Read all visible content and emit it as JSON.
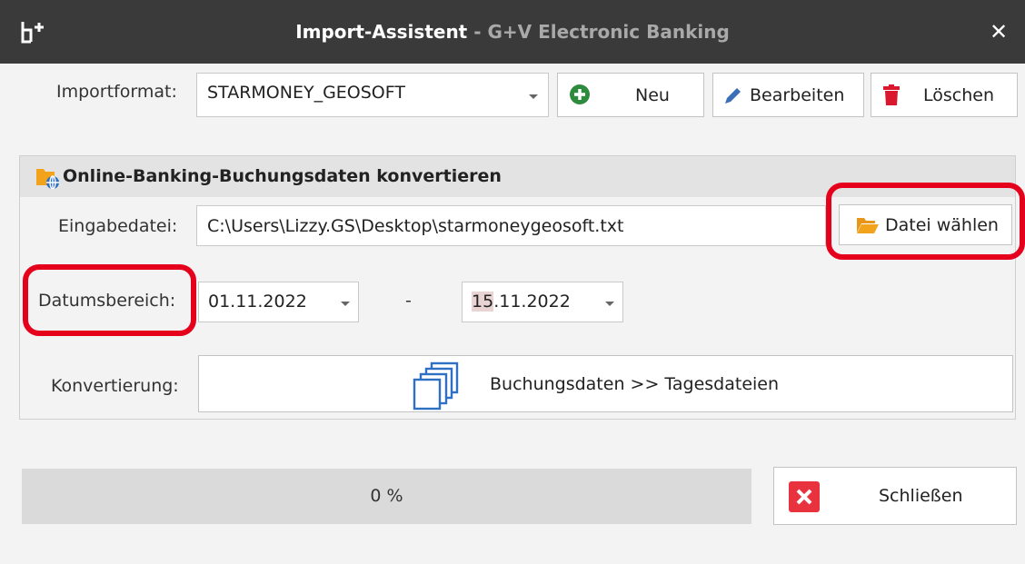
{
  "window": {
    "title": "Import-Assistent",
    "subtitle": " - G+V Electronic Banking",
    "close_glyph": "✕"
  },
  "toolbar": {
    "import_format_label": "Importformat:",
    "import_format_value": "STARMONEY_GEOSOFT",
    "new_label": "Neu",
    "edit_label": "Bearbeiten",
    "delete_label": "Löschen"
  },
  "group": {
    "header": "Online-Banking-Buchungsdaten konvertieren",
    "input_file_label": "Eingabedatei:",
    "input_file_value": "C:\\Users\\Lizzy.GS\\Desktop\\starmoneygeosoft.txt",
    "choose_file_label": "Datei wählen",
    "date_range_label": "Datumsbereich:",
    "date_from": "01.11.2022",
    "date_separator": "-",
    "date_to_day": "15",
    "date_to_rest": ".11.2022",
    "conversion_label": "Konvertierung:",
    "conversion_button_label": "Buchungsdaten >> Tagesdateien"
  },
  "footer": {
    "progress_text": "0 %",
    "progress_value": 0,
    "close_label": "Schließen"
  },
  "colors": {
    "titlebar": "#3a3a3a",
    "highlight": "#e5001b",
    "delete_icon": "#d9182d",
    "new_icon": "#2e8b3e",
    "folder_icon": "#f2a31b",
    "close_button_bg": "#e8333f"
  },
  "icons": {
    "app": "import-wizard-icon",
    "new": "plus-circle-icon",
    "edit": "pencil-icon",
    "delete": "trash-icon",
    "folder": "folder-open-icon",
    "group": "folder-globe-icon",
    "convert": "copy-stack-icon",
    "close": "x-square-icon"
  }
}
